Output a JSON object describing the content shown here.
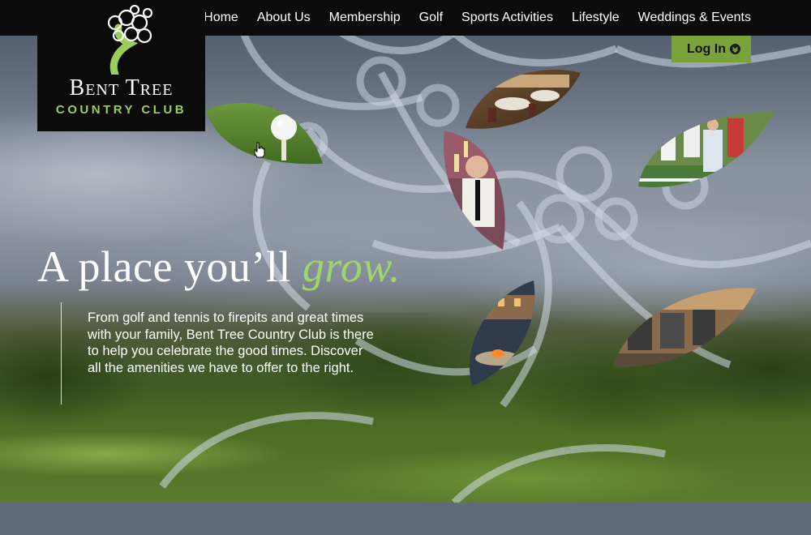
{
  "nav": {
    "items": [
      "Home",
      "About Us",
      "Membership",
      "Golf",
      "Sports Activities",
      "Lifestyle",
      "Weddings & Events"
    ]
  },
  "logo": {
    "name": "Bent Tree",
    "subtitle": "COUNTRY CLUB"
  },
  "login": {
    "label": "Log In",
    "icon": "chevron-down-circle-icon"
  },
  "hero": {
    "headline_main": "A place you’ll",
    "headline_accent": "grow.",
    "intro": "From golf and tennis to firepits and great times with your family, Bent Tree Country Club is there to help you celebrate the good times. Discover all the amenities we have to offer to the right."
  },
  "photos": [
    "golf-ball-on-tee",
    "dining-room",
    "celebration-toast",
    "kids-tennis",
    "firepit-patio",
    "fitness-center"
  ],
  "colors": {
    "brand_green": "#79a33a",
    "accent_green": "#9fd56a",
    "header_black": "#0b0b0b"
  }
}
